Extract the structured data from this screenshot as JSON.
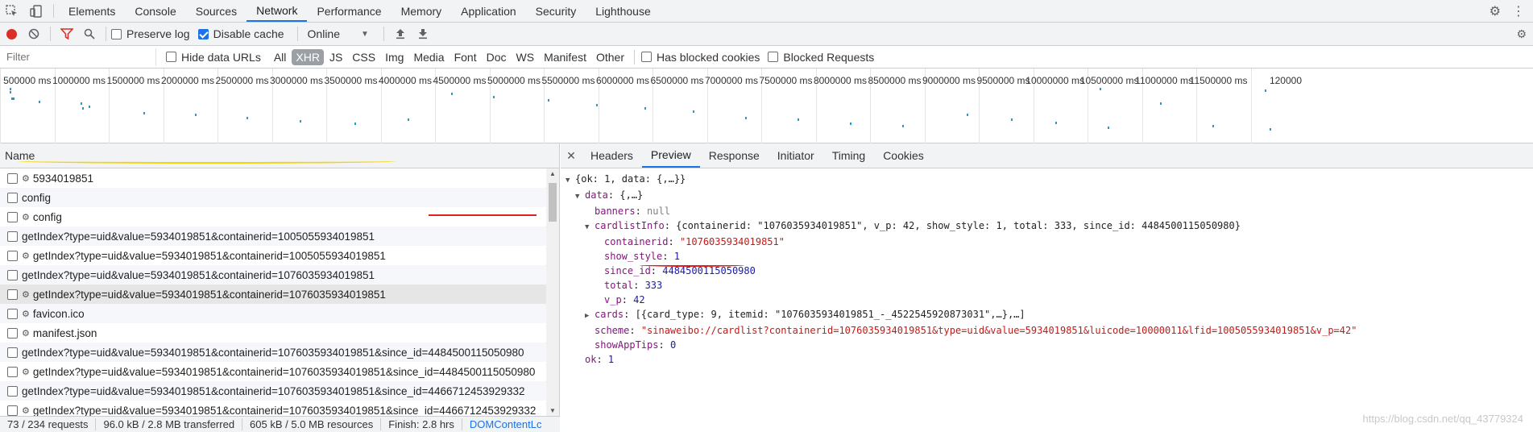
{
  "main_tabs": [
    "Elements",
    "Console",
    "Sources",
    "Network",
    "Performance",
    "Memory",
    "Application",
    "Security",
    "Lighthouse"
  ],
  "active_tab": "Network",
  "toolbar": {
    "preserve_log": "Preserve log",
    "disable_cache": "Disable cache",
    "throttle": "Online"
  },
  "filter": {
    "placeholder": "Filter",
    "hide_data_urls": "Hide data URLs",
    "types": [
      "All",
      "XHR",
      "JS",
      "CSS",
      "Img",
      "Media",
      "Font",
      "Doc",
      "WS",
      "Manifest",
      "Other"
    ],
    "active_type": "XHR",
    "has_blocked_cookies": "Has blocked cookies",
    "blocked_requests": "Blocked Requests"
  },
  "overview": {
    "ticks": [
      "500000 ms",
      "1000000 ms",
      "1500000 ms",
      "2000000 ms",
      "2500000 ms",
      "3000000 ms",
      "3500000 ms",
      "4000000 ms",
      "4500000 ms",
      "5000000 ms",
      "5500000 ms",
      "6000000 ms",
      "6500000 ms",
      "7000000 ms",
      "7500000 ms",
      "8000000 ms",
      "8500000 ms",
      "9000000 ms",
      "9500000 ms",
      "10000000 ms",
      "10500000 ms",
      "11000000 ms",
      "11500000 ms",
      "120000"
    ]
  },
  "requests": {
    "column_name": "Name",
    "rows": [
      {
        "name": "5934019851",
        "gear": true
      },
      {
        "name": "config",
        "gear": false
      },
      {
        "name": "config",
        "gear": true
      },
      {
        "name": "getIndex?type=uid&value=5934019851&containerid=1005055934019851",
        "gear": false
      },
      {
        "name": "getIndex?type=uid&value=5934019851&containerid=1005055934019851",
        "gear": true
      },
      {
        "name": "getIndex?type=uid&value=5934019851&containerid=1076035934019851",
        "gear": false
      },
      {
        "name": "getIndex?type=uid&value=5934019851&containerid=1076035934019851",
        "gear": true
      },
      {
        "name": "favicon.ico",
        "gear": true
      },
      {
        "name": "manifest.json",
        "gear": true
      },
      {
        "name": "getIndex?type=uid&value=5934019851&containerid=1076035934019851&since_id=4484500115050980",
        "gear": false
      },
      {
        "name": "getIndex?type=uid&value=5934019851&containerid=1076035934019851&since_id=4484500115050980",
        "gear": true
      },
      {
        "name": "getIndex?type=uid&value=5934019851&containerid=1076035934019851&since_id=4466712453929332",
        "gear": false
      },
      {
        "name": "getIndex?type=uid&value=5934019851&containerid=1076035934019851&since_id=4466712453929332",
        "gear": true
      }
    ],
    "selected_index": 6
  },
  "detail_tabs": [
    "Headers",
    "Preview",
    "Response",
    "Initiator",
    "Timing",
    "Cookies"
  ],
  "active_detail_tab": "Preview",
  "preview": {
    "root": "{ok: 1, data: {,…}}",
    "data_summary": "{,…}",
    "banners": "null",
    "cardlistInfo_summary": "{containerid: \"1076035934019851\", v_p: 42, show_style: 1, total: 333, since_id: 4484500115050980}",
    "containerid": "\"1076035934019851\"",
    "show_style": "1",
    "since_id": "4484500115050980",
    "total": "333",
    "v_p": "42",
    "cards_summary": "[{card_type: 9, itemid: \"1076035934019851_-_4522545920873031\",…},…]",
    "scheme": "\"sinaweibo://cardlist?containerid=1076035934019851&type=uid&value=5934019851&luicode=10000011&lfid=1005055934019851&v_p=42\"",
    "showAppTips": "0",
    "ok": "1"
  },
  "status": {
    "requests": "73 / 234 requests",
    "transferred": "96.0 kB / 2.8 MB transferred",
    "resources": "605 kB / 5.0 MB resources",
    "finish": "Finish: 2.8 hrs",
    "dcl": "DOMContentLc"
  },
  "watermark": "https://blog.csdn.net/qq_43779324",
  "colors": {
    "accent": "#1a73e8",
    "record": "#d93025",
    "key": "#881280",
    "string": "#c41a16",
    "number": "#1a1aa6"
  }
}
